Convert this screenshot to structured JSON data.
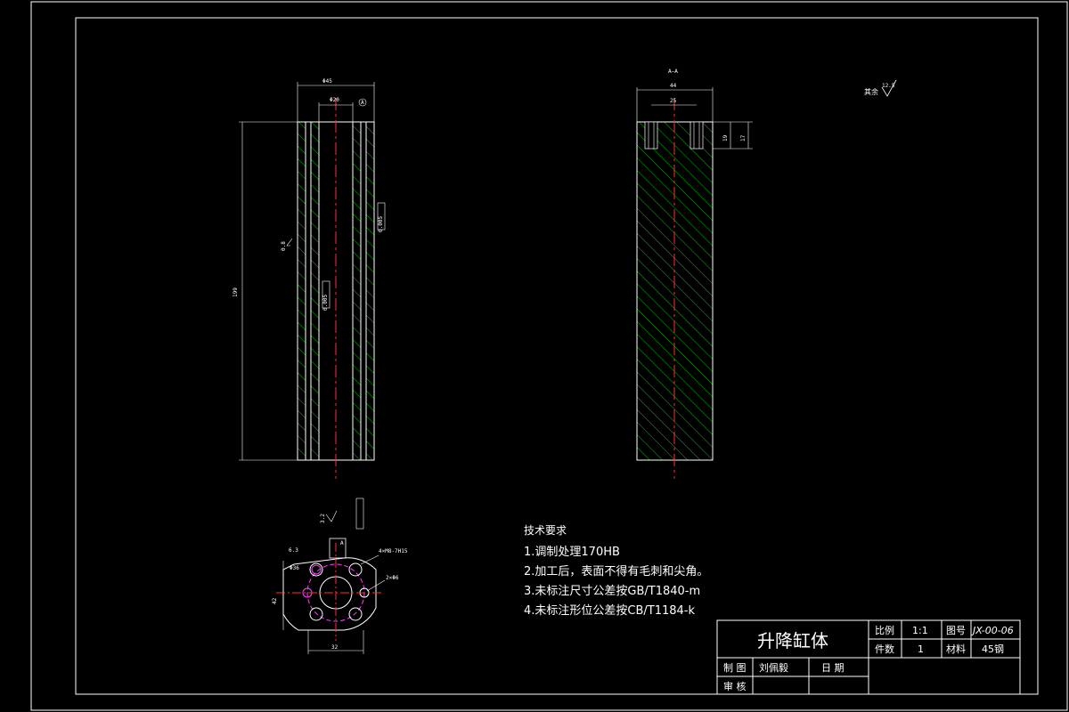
{
  "colors": {
    "background": "#000000",
    "line": "#ffffff",
    "hatch": "#00c000",
    "centerline": "#ff3030",
    "magenta": "#ff40ff"
  },
  "views": {
    "front": {
      "dims": {
        "outer_dia": "Φ45",
        "bore": "Φ20",
        "length": "199",
        "ra": "0.8",
        "tol1": "0.005",
        "tol2": "0.005",
        "datum": "A"
      }
    },
    "section": {
      "label": "A—A",
      "dims": {
        "width": "44",
        "hole_spacing": "25",
        "depth1": "19",
        "depth2": "17"
      }
    },
    "end": {
      "dims": {
        "thread": "4×M8-7H15",
        "hole": "2×Φ6",
        "width": "32",
        "height": "42",
        "ra": "3.2",
        "r1": "6.3",
        "dia_small": "Φ36",
        "datum": "A"
      }
    }
  },
  "surface_note": {
    "label": "其余",
    "value": "12.5"
  },
  "notes": {
    "title": "技术要求",
    "items": [
      "1.调制处理170HB",
      "2.加工后，表面不得有毛刺和尖角。",
      "3.未标注尺寸公差按GB/T1840-m",
      "4.未标注形位公差按CB/T1184-k"
    ]
  },
  "title_block": {
    "part_name": "升降缸体",
    "scale_label": "比例",
    "scale_value": "1:1",
    "drawing_no_label": "图号",
    "drawing_no_value": "JX-00-06",
    "qty_label": "件数",
    "qty_value": "1",
    "material_label": "材料",
    "material_value": "45钢",
    "drawn_label": "制 图",
    "drawn_value": "刘佩毅",
    "date_label": "日    期",
    "check_label": "审 核"
  }
}
